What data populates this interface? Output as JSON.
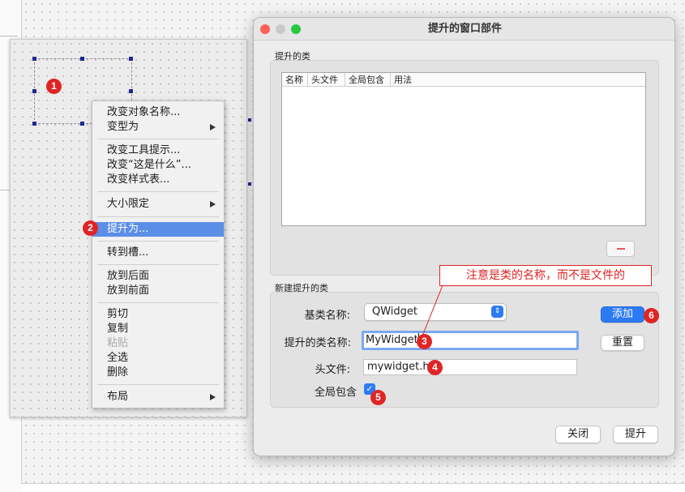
{
  "context_menu": {
    "items": [
      {
        "label": "改变对象名称...",
        "submenu": false,
        "enabled": true
      },
      {
        "label": "变型为",
        "submenu": true,
        "enabled": true
      },
      {
        "label": "改变工具提示...",
        "submenu": false,
        "enabled": true
      },
      {
        "label": "改变“这是什么”...",
        "submenu": false,
        "enabled": true
      },
      {
        "label": "改变样式表...",
        "submenu": false,
        "enabled": true
      },
      {
        "label": "大小限定",
        "submenu": true,
        "enabled": true
      },
      {
        "label": "提升为...",
        "submenu": false,
        "enabled": true,
        "highlighted": true
      },
      {
        "label": "转到槽...",
        "submenu": false,
        "enabled": true
      },
      {
        "label": "放到后面",
        "submenu": false,
        "enabled": true
      },
      {
        "label": "放到前面",
        "submenu": false,
        "enabled": true
      },
      {
        "label": "剪切",
        "submenu": false,
        "enabled": true
      },
      {
        "label": "复制",
        "submenu": false,
        "enabled": true
      },
      {
        "label": "粘贴",
        "submenu": false,
        "enabled": false
      },
      {
        "label": "全选",
        "submenu": false,
        "enabled": true
      },
      {
        "label": "删除",
        "submenu": false,
        "enabled": true
      },
      {
        "label": "布局",
        "submenu": true,
        "enabled": true
      }
    ]
  },
  "dialog": {
    "title": "提升的窗口部件",
    "promoted_group_title": "提升的类",
    "table_columns": [
      "名称",
      "头文件",
      "全局包含",
      "用法"
    ],
    "new_group_title": "新建提升的类",
    "base_class_label": "基类名称:",
    "base_class_value": "QWidget",
    "class_name_label": "提升的类名称:",
    "class_name_value": "MyWidget",
    "header_file_label": "头文件:",
    "header_file_value": "mywidget.h",
    "global_include_label": "全局包含",
    "global_include_checked": true,
    "add_label": "添加",
    "reset_label": "重置",
    "close_label": "关闭",
    "promote_label": "提升"
  },
  "annotation": {
    "note": "注意是类的名称，而不是文件的"
  },
  "badges": [
    "1",
    "2",
    "3",
    "4",
    "5",
    "6"
  ],
  "colors": {
    "accent": "#2d7bf4",
    "menu_highlight": "#5b8ee6",
    "badge": "#e02424",
    "traffic_close": "#fe5f57",
    "traffic_minimize": "#c9c9c9",
    "traffic_zoom": "#28c840"
  }
}
